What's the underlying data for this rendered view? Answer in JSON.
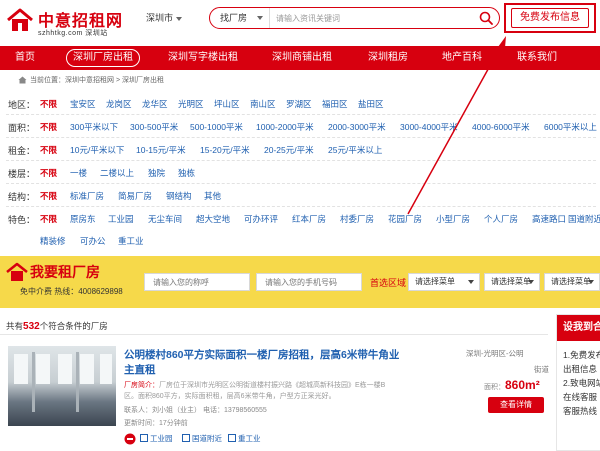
{
  "header": {
    "logo_title": "中意招租网",
    "logo_sub": "szhhtkg.com 深圳站",
    "city": "深圳市",
    "search_type": "找厂房",
    "search_placeholder": "请输入资讯关键词",
    "publish_label": "免费发布信息"
  },
  "nav": {
    "items": [
      "首页",
      "深圳厂房出租",
      "深圳写字楼出租",
      "深圳商铺出租",
      "深圳租房",
      "地产百科",
      "联系我们"
    ]
  },
  "breadcrumb": "当前位置：深圳中意招租网 > 深圳厂房出租",
  "filters": [
    {
      "label": "地区：",
      "options": [
        "不限",
        "宝安区",
        "龙岗区",
        "龙华区",
        "光明区",
        "坪山区",
        "南山区",
        "罗湖区",
        "福田区",
        "盐田区"
      ]
    },
    {
      "label": "面积：",
      "options": [
        "不限",
        "300平米以下",
        "300-500平米",
        "500-1000平米",
        "1000-2000平米",
        "2000-3000平米",
        "3000-4000平米",
        "4000-6000平米",
        "6000平米以上"
      ]
    },
    {
      "label": "租金：",
      "options": [
        "不限",
        "10元/平米以下",
        "10-15元/平米",
        "15-20元/平米",
        "20-25元/平米",
        "25元/平米以上"
      ]
    },
    {
      "label": "楼层：",
      "options": [
        "不限",
        "一楼",
        "二楼以上",
        "独院",
        "独栋"
      ]
    },
    {
      "label": "结构：",
      "options": [
        "不限",
        "标准厂房",
        "简易厂房",
        "钢结构",
        "其他"
      ]
    },
    {
      "label": "特色：",
      "options": [
        "不限",
        "原房东",
        "工业园",
        "无尘车间",
        "超大空地",
        "可办环评",
        "红本厂房",
        "村委厂房",
        "花园厂房",
        "小型厂房",
        "个人厂房",
        "高速路口",
        "国道附近"
      ]
    },
    {
      "label": "",
      "options": [
        "精装修",
        "可办公",
        "重工业"
      ]
    }
  ],
  "rent_bar": {
    "title": "我要租厂房",
    "subtitle": "免中介费 热线：4008629898",
    "name_placeholder": "请输入您的称呼",
    "phone_placeholder": "请输入您的手机号码",
    "area_label": "首选区域",
    "select1": "请选择菜单",
    "select2": "请选择菜单",
    "select3": "请选择菜单"
  },
  "results": {
    "prefix": "共有",
    "count": "532",
    "suffix": "个符合条件的厂房"
  },
  "listing": {
    "title": "公明楼村860平方实际面积一楼厂房招租，层高6米带牛角业主直租",
    "desc_tag": "厂房简介：",
    "desc": "厂房位于深圳市光明区公明街道楼村振兴路《超城高新科技园》E栋一楼B区。面积860平方，实际面积租，层高6米带牛角，户型方正采光好。",
    "contact": "联系人：刘小姐（业主） 电话：13798560555",
    "time": "更新时间：17分钟前",
    "tags": [
      "工业园",
      "国道附近",
      "重工业"
    ],
    "location_a": "深圳-光明区-公明",
    "location_b": "街道",
    "area_label": "面积：",
    "area_value": "860m²",
    "button": "查看详情"
  },
  "side": {
    "title": "设我到合",
    "lines": [
      "1.免费发布",
      "出租信息",
      "2.致电网站",
      "在线客服",
      "客服热线"
    ]
  },
  "colors": {
    "brand_red": "#d7000f",
    "link_blue": "#2060b0",
    "rent_yellow": "#f6d94a"
  }
}
